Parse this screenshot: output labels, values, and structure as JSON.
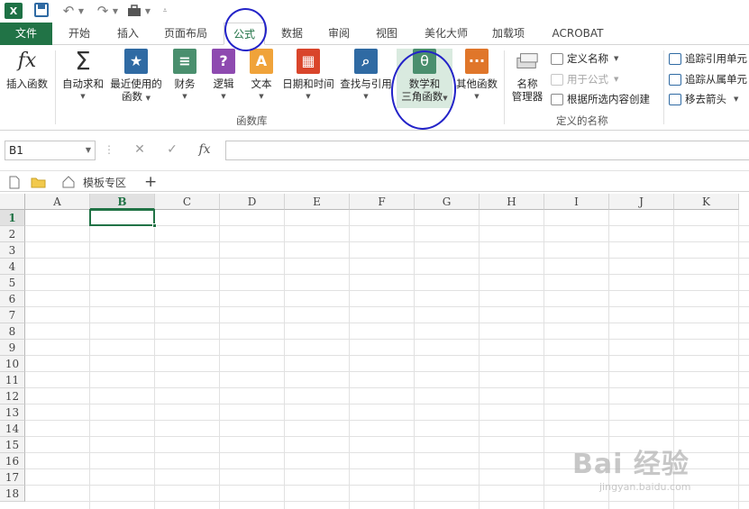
{
  "quick_access": {
    "icons": [
      "excel-logo",
      "save-icon",
      "undo-icon",
      "redo-icon",
      "toolbox-icon",
      "customize-icon"
    ]
  },
  "tabs": [
    {
      "label": "文件",
      "active": false
    },
    {
      "label": "开始",
      "active": false
    },
    {
      "label": "插入",
      "active": false
    },
    {
      "label": "页面布局",
      "active": false
    },
    {
      "label": "公式",
      "active": true
    },
    {
      "label": "数据",
      "active": false
    },
    {
      "label": "审阅",
      "active": false
    },
    {
      "label": "视图",
      "active": false
    },
    {
      "label": "美化大师",
      "active": false
    },
    {
      "label": "加载项",
      "active": false
    },
    {
      "label": "ACROBAT",
      "active": false
    }
  ],
  "ribbon": {
    "function_library": {
      "group_label": "函数库",
      "buttons": [
        {
          "line1": "插入函数",
          "line2": "",
          "icon": "fx-icon"
        },
        {
          "line1": "自动求和",
          "line2": "",
          "icon": "sigma-icon"
        },
        {
          "line1": "最近使用的",
          "line2": "函数",
          "icon": "star-icon"
        },
        {
          "line1": "财务",
          "line2": "",
          "icon": "finance-icon"
        },
        {
          "line1": "逻辑",
          "line2": "",
          "icon": "question-icon"
        },
        {
          "line1": "文本",
          "line2": "",
          "icon": "text-icon"
        },
        {
          "line1": "日期和时间",
          "line2": "",
          "icon": "calendar-icon"
        },
        {
          "line1": "查找与引用",
          "line2": "",
          "icon": "lookup-icon"
        },
        {
          "line1": "数学和",
          "line2": "三角函数",
          "icon": "theta-icon"
        },
        {
          "line1": "其他函数",
          "line2": "",
          "icon": "more-icon"
        }
      ]
    },
    "defined_names": {
      "group_label": "定义的名称",
      "name_manager": {
        "line1": "名称",
        "line2": "管理器"
      },
      "define_name": "定义名称",
      "use_in_formula": "用于公式",
      "create_from_selection": "根据所选内容创建"
    },
    "formula_auditing": {
      "trace_precedents": "追踪引用单元",
      "trace_dependents": "追踪从属单元",
      "remove_arrows": "移去箭头"
    }
  },
  "formula_bar": {
    "name_box": "B1",
    "cancel_glyph": "✕",
    "enter_glyph": "✓",
    "fx_glyph": "fx",
    "formula": ""
  },
  "sheet_strip": {
    "template_tab": "模板专区",
    "add_glyph": "+"
  },
  "grid": {
    "columns": [
      "A",
      "B",
      "C",
      "D",
      "E",
      "F",
      "G",
      "H",
      "I",
      "J",
      "K"
    ],
    "rows": [
      "1",
      "2",
      "3",
      "4",
      "5",
      "6",
      "7",
      "8",
      "9",
      "10",
      "11",
      "12",
      "13",
      "14",
      "15",
      "16",
      "17",
      "18"
    ],
    "selected_cell": "B1"
  },
  "watermark": {
    "main": "Bai 经验",
    "sub": "jingyan.baidu.com"
  },
  "colors": {
    "brand_green": "#217346",
    "annotation_blue": "#2323c8",
    "highlight_green": "#d9eadf"
  }
}
